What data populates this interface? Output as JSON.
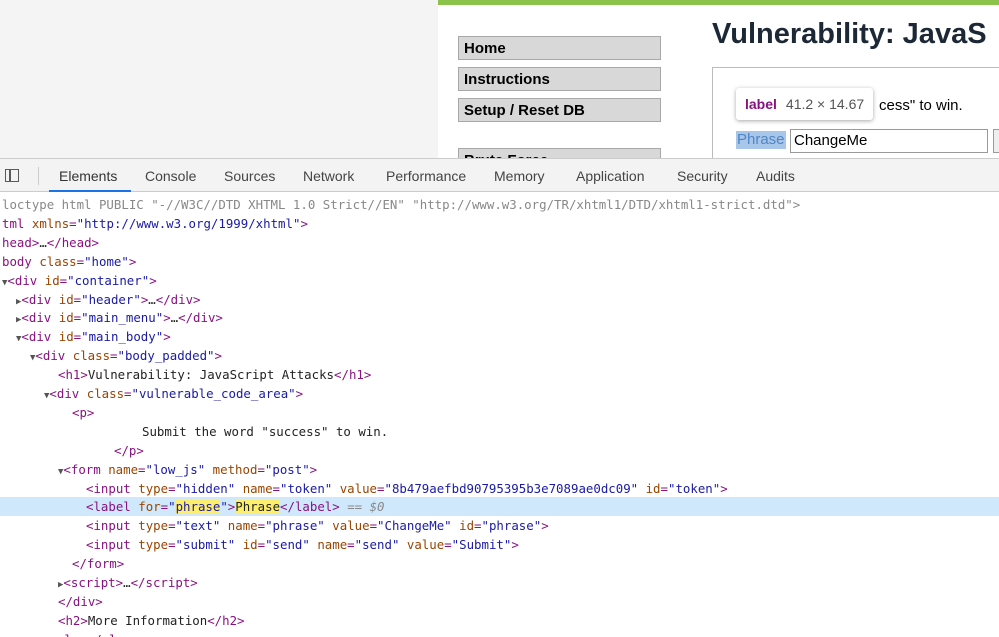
{
  "page": {
    "menu": [
      "Home",
      "Instructions",
      "Setup / Reset DB",
      "Brute Force"
    ],
    "title": "Vulnerability: JavaS",
    "instruction_fragment": "cess\" to win.",
    "phrase_label": "Phrase",
    "phrase_value": "ChangeMe",
    "tooltip": {
      "tag": "label",
      "dims": "41.2 × 14.67"
    }
  },
  "devtools": {
    "tabs": [
      "Elements",
      "Console",
      "Sources",
      "Network",
      "Performance",
      "Memory",
      "Application",
      "Security",
      "Audits"
    ],
    "active_tab": "Elements",
    "lines": [
      {
        "i": 0,
        "a": "",
        "h": "<span class=\"gr\">loctype html PUBLIC \"-//W3C//DTD XHTML 1.0 Strict//EN\" \"http://www.w3.org/TR/xhtml1/DTD/xhtml1-strict.dtd\"&gt;</span>"
      },
      {
        "i": 0,
        "a": "",
        "h": "<span class=\"tg\">tml</span> <span class=\"an\">xmlns</span><span class=\"tg\">=</span><span class=\"av\">\"http://www.w3.org/1999/xhtml\"</span><span class=\"tg\">&gt;</span>"
      },
      {
        "i": 0,
        "a": "",
        "h": "<span class=\"tg\">head&gt;</span><span class=\"tx\">…</span><span class=\"tg\">&lt;/head&gt;</span>"
      },
      {
        "i": 0,
        "a": "",
        "h": "<span class=\"tg\">body</span> <span class=\"an\">class</span><span class=\"tg\">=</span><span class=\"av\">\"home\"</span><span class=\"tg\">&gt;</span>"
      },
      {
        "i": 0,
        "a": "▼",
        "h": "<span class=\"tg\">&lt;div</span> <span class=\"an\">id</span><span class=\"tg\">=</span><span class=\"av\">\"container\"</span><span class=\"tg\">&gt;</span>"
      },
      {
        "i": 1,
        "a": "▶",
        "h": "<span class=\"tg\">&lt;div</span> <span class=\"an\">id</span><span class=\"tg\">=</span><span class=\"av\">\"header\"</span><span class=\"tg\">&gt;</span><span class=\"tx\">…</span><span class=\"tg\">&lt;/div&gt;</span>"
      },
      {
        "i": 1,
        "a": "▶",
        "h": "<span class=\"tg\">&lt;div</span> <span class=\"an\">id</span><span class=\"tg\">=</span><span class=\"av\">\"main_menu\"</span><span class=\"tg\">&gt;</span><span class=\"tx\">…</span><span class=\"tg\">&lt;/div&gt;</span>"
      },
      {
        "i": 1,
        "a": "▼",
        "h": "<span class=\"tg\">&lt;div</span> <span class=\"an\">id</span><span class=\"tg\">=</span><span class=\"av\">\"main_body\"</span><span class=\"tg\">&gt;</span>"
      },
      {
        "i": 2,
        "a": "▼",
        "h": "<span class=\"tg\">&lt;div</span> <span class=\"an\">class</span><span class=\"tg\">=</span><span class=\"av\">\"body_padded\"</span><span class=\"tg\">&gt;</span>"
      },
      {
        "i": 4,
        "a": "",
        "h": "<span class=\"tg\">&lt;h1&gt;</span><span class=\"tx\">Vulnerability: JavaScript Attacks</span><span class=\"tg\">&lt;/h1&gt;</span>"
      },
      {
        "i": 3,
        "a": "▼",
        "h": "<span class=\"tg\">&lt;div</span> <span class=\"an\">class</span><span class=\"tg\">=</span><span class=\"av\">\"vulnerable_code_area\"</span><span class=\"tg\">&gt;</span>"
      },
      {
        "i": 5,
        "a": "",
        "h": "<span class=\"tg\">&lt;p&gt;</span>"
      },
      {
        "i": 10,
        "a": "",
        "h": "<span class=\"tx\">Submit the word \"success\" to win.</span>"
      },
      {
        "i": 8,
        "a": "",
        "h": "<span class=\"tg\">&lt;/p&gt;</span>"
      },
      {
        "i": 4,
        "a": "▼",
        "h": "<span class=\"tg\">&lt;form</span> <span class=\"an\">name</span><span class=\"tg\">=</span><span class=\"av\">\"low_js\"</span> <span class=\"an\">method</span><span class=\"tg\">=</span><span class=\"av\">\"post\"</span><span class=\"tg\">&gt;</span>"
      },
      {
        "i": 6,
        "a": "",
        "h": "<span class=\"tg\">&lt;input</span> <span class=\"an\">type</span><span class=\"tg\">=</span><span class=\"av\">\"hidden\"</span> <span class=\"an\">name</span><span class=\"tg\">=</span><span class=\"av\">\"token\"</span> <span class=\"an\">value</span><span class=\"tg\">=</span><span class=\"av\">\"8b479aefbd90795395b3e7089ae0dc09\"</span> <span class=\"an\">id</span><span class=\"tg\">=</span><span class=\"av\">\"token\"</span><span class=\"tg\">&gt;</span>"
      },
      {
        "i": 6,
        "a": "",
        "sel": true,
        "h": "<span class=\"tg\">&lt;label</span> <span class=\"an\">for</span><span class=\"tg\">=</span><span class=\"av\">\"<span class=\"hl\">phrase</span>\"</span><span class=\"tg\">&gt;</span><span class=\"tx hl\">Phrase</span><span class=\"tg\">&lt;/label&gt;</span> <span class=\"eq\">== $0</span>"
      },
      {
        "i": 6,
        "a": "",
        "h": "<span class=\"tg\">&lt;input</span> <span class=\"an\">type</span><span class=\"tg\">=</span><span class=\"av\">\"text\"</span> <span class=\"an\">name</span><span class=\"tg\">=</span><span class=\"av\">\"phrase\"</span> <span class=\"an\">value</span><span class=\"tg\">=</span><span class=\"av\">\"ChangeMe\"</span> <span class=\"an\">id</span><span class=\"tg\">=</span><span class=\"av\">\"phrase\"</span><span class=\"tg\">&gt;</span>"
      },
      {
        "i": 6,
        "a": "",
        "h": "<span class=\"tg\">&lt;input</span> <span class=\"an\">type</span><span class=\"tg\">=</span><span class=\"av\">\"submit\"</span> <span class=\"an\">id</span><span class=\"tg\">=</span><span class=\"av\">\"send\"</span> <span class=\"an\">name</span><span class=\"tg\">=</span><span class=\"av\">\"send\"</span> <span class=\"an\">value</span><span class=\"tg\">=</span><span class=\"av\">\"Submit\"</span><span class=\"tg\">&gt;</span>"
      },
      {
        "i": 5,
        "a": "",
        "h": "<span class=\"tg\">&lt;/form&gt;</span>"
      },
      {
        "i": 4,
        "a": "▶",
        "h": "<span class=\"tg\">&lt;script&gt;</span><span class=\"tx\">…</span><span class=\"tg\">&lt;/script&gt;</span>"
      },
      {
        "i": 4,
        "a": "",
        "h": "<span class=\"tg\">&lt;/div&gt;</span>"
      },
      {
        "i": 4,
        "a": "",
        "h": "<span class=\"tg\">&lt;h2&gt;</span><span class=\"tx\">More Information</span><span class=\"tg\">&lt;/h2&gt;</span>"
      },
      {
        "i": 3,
        "a": "▶",
        "h": "<span class=\"tg\">&lt;ul&gt;</span><span class=\"tx\">…</span><span class=\"tg\">&lt;/ul&gt;</span>"
      }
    ]
  }
}
